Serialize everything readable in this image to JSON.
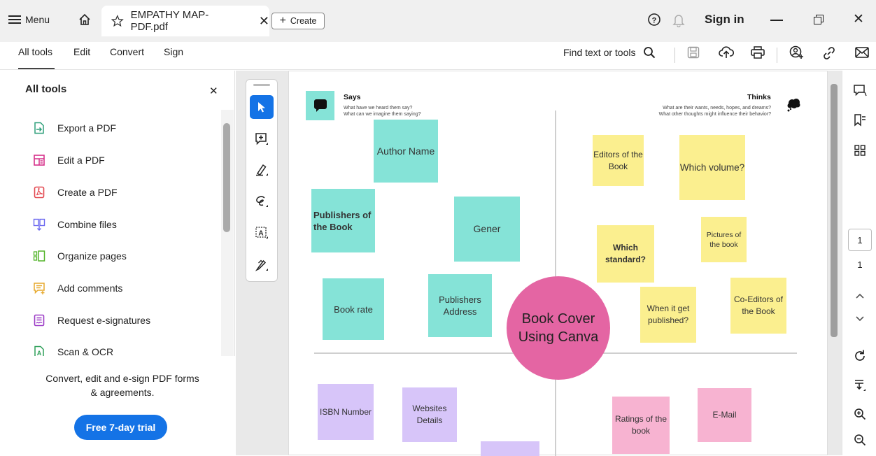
{
  "titlebar": {
    "menu_label": "Menu",
    "tab_title": "EMPATHY MAP-PDF.pdf",
    "create_label": "Create",
    "signin_label": "Sign in"
  },
  "toolbar": {
    "tabs": [
      "All tools",
      "Edit",
      "Convert",
      "Sign"
    ],
    "find_label": "Find text or tools"
  },
  "left_panel": {
    "title": "All tools",
    "tools": [
      {
        "label": "Export a PDF",
        "icon": "export-pdf-icon",
        "color": "#2e9f7a"
      },
      {
        "label": "Edit a PDF",
        "icon": "edit-pdf-icon",
        "color": "#d6318a"
      },
      {
        "label": "Create a PDF",
        "icon": "create-pdf-icon",
        "color": "#e34850"
      },
      {
        "label": "Combine files",
        "icon": "combine-files-icon",
        "color": "#6a67f0"
      },
      {
        "label": "Organize pages",
        "icon": "organize-pages-icon",
        "color": "#52b329"
      },
      {
        "label": "Add comments",
        "icon": "add-comments-icon",
        "color": "#e7a92d"
      },
      {
        "label": "Request e-signatures",
        "icon": "request-esign-icon",
        "color": "#9c3cc6"
      },
      {
        "label": "Scan & OCR",
        "icon": "scan-ocr-icon",
        "color": "#2e9f58"
      }
    ],
    "promo_text": "Convert, edit and e-sign PDF forms & agreements.",
    "trial_label": "Free 7-day trial",
    "trial_color": "#1473e6"
  },
  "right_rail": {
    "page_current": "1",
    "page_total": "1"
  },
  "document": {
    "says": {
      "heading": "Says",
      "line1": "What have we heard them say?",
      "line2": "What can we imagine them saying?"
    },
    "thinks": {
      "heading": "Thinks",
      "line1": "What are their wants, needs, hopes, and dreams?",
      "line2": "What other thoughts might influence their behavior?"
    },
    "center": "Book Cover Using Canva",
    "stickies": {
      "author": "Author Name",
      "publishers": "Publishers of the Book",
      "gener": "Gener",
      "book_rate": "Book rate",
      "pub_address": "Publishers Address",
      "editors": "Editors of the Book",
      "which_volume": "Which volume?",
      "which_standard": "Which standard?",
      "pictures": "Pictures of the book",
      "when_published": "When it get published?",
      "co_editors": "Co-Editors of the Book",
      "isbn": "ISBN Number",
      "websites": "Websites Details",
      "ratings": "Ratings of the book",
      "email": "E-Mail"
    }
  }
}
